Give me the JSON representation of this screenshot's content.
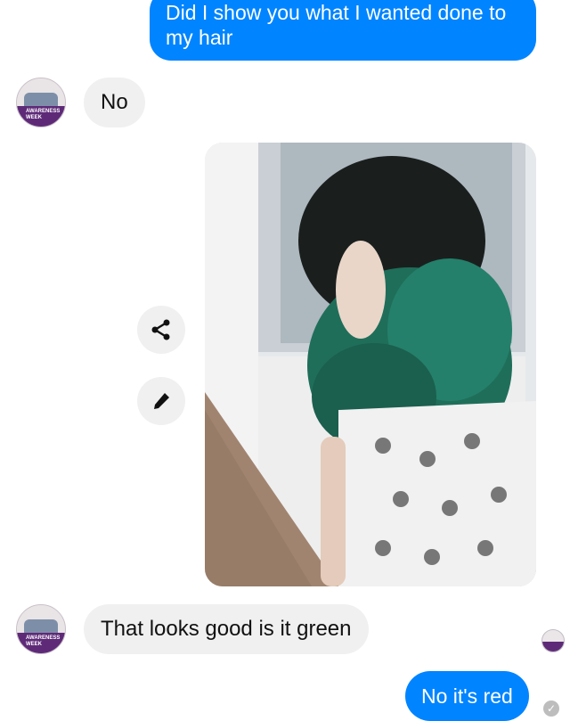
{
  "messages": [
    {
      "sender": "me",
      "text": "Did I show you what I wanted done to my hair"
    },
    {
      "sender": "them",
      "text": "No"
    },
    {
      "sender": "me",
      "type": "image",
      "description_icon": "hair-photo"
    },
    {
      "sender": "them",
      "text": "That looks good is it green"
    },
    {
      "sender": "me",
      "text": "No it's red"
    }
  ],
  "avatar": {
    "banner_text": "AWARENESS WEEK"
  },
  "actions": {
    "share_icon": "share-icon",
    "edit_icon": "pencil-icon"
  },
  "colors": {
    "outgoing": "#0084ff",
    "incoming": "#f1f0f0",
    "hair": "#1f6e5a"
  }
}
